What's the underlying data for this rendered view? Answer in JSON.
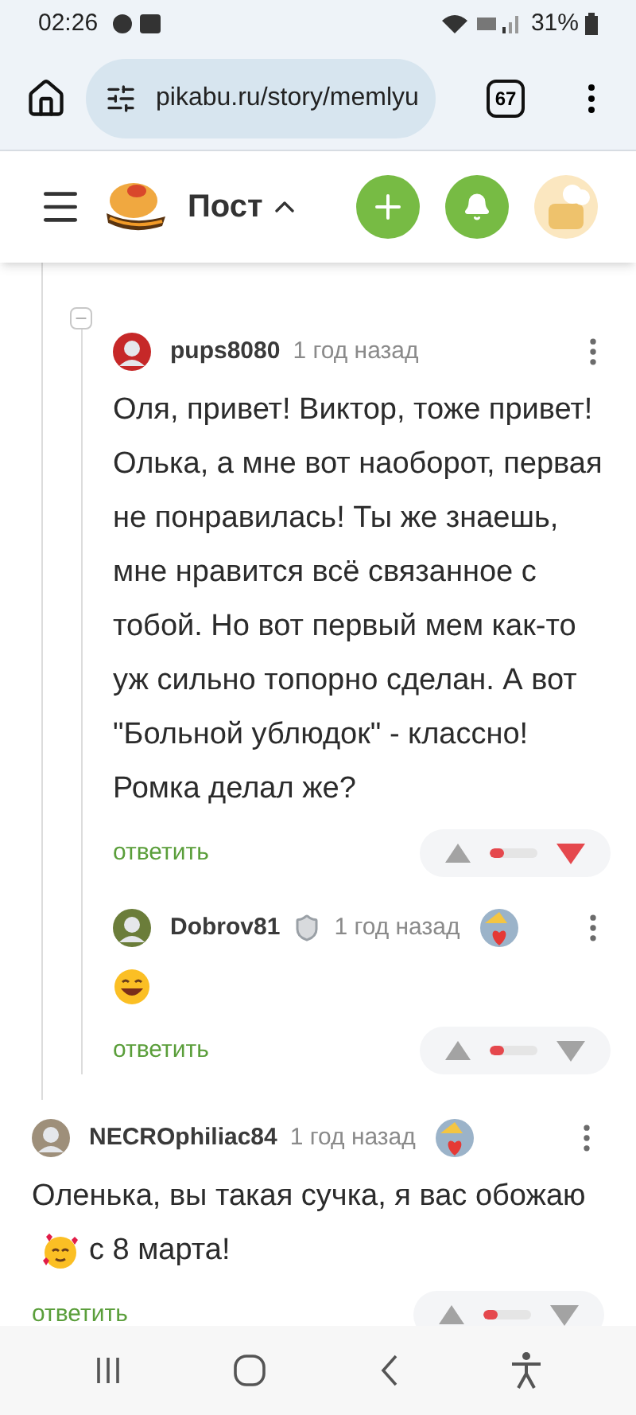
{
  "status_bar": {
    "time": "02:26",
    "battery": "31%"
  },
  "browser": {
    "url": "pikabu.ru/story/memlyu",
    "tab_count": "67"
  },
  "header": {
    "title": "Пост"
  },
  "thread": [
    {
      "user": "pups8080",
      "time": "1 год назад",
      "shield": false,
      "award": false,
      "body": [
        {
          "kind": "text",
          "text": "Оля, привет! Виктор, тоже привет! Олька, а мне вот наоборот, первая не понравилась! Ты же знаешь, мне нравится всё связанное с тобой. Но вот первый мем как-то уж сильно топорно сделан. А вот \"Больной ублюдок\" - классно! Ромка делал же?"
        }
      ],
      "reply": "ответить",
      "rating": {
        "level": 0.3,
        "downvoted": true
      },
      "children": [
        {
          "user": "Dobrov81",
          "time": "1 год назад",
          "shield": true,
          "award": true,
          "body": [
            {
              "kind": "grin"
            }
          ],
          "reply": "ответить",
          "rating": {
            "level": 0.3,
            "downvoted": false
          }
        }
      ]
    }
  ],
  "top_comments": [
    {
      "user": "NECROphiliac84",
      "time": "1 год назад",
      "shield": false,
      "award": true,
      "body": [
        {
          "kind": "text",
          "text": "Оленька, вы такая сучка, я вас обожаю"
        },
        {
          "kind": "hearts"
        },
        {
          "kind": "text",
          "text": "с 8 марта!"
        }
      ],
      "reply": "ответить",
      "rating": {
        "level": 0.3,
        "downvoted": false
      }
    }
  ]
}
